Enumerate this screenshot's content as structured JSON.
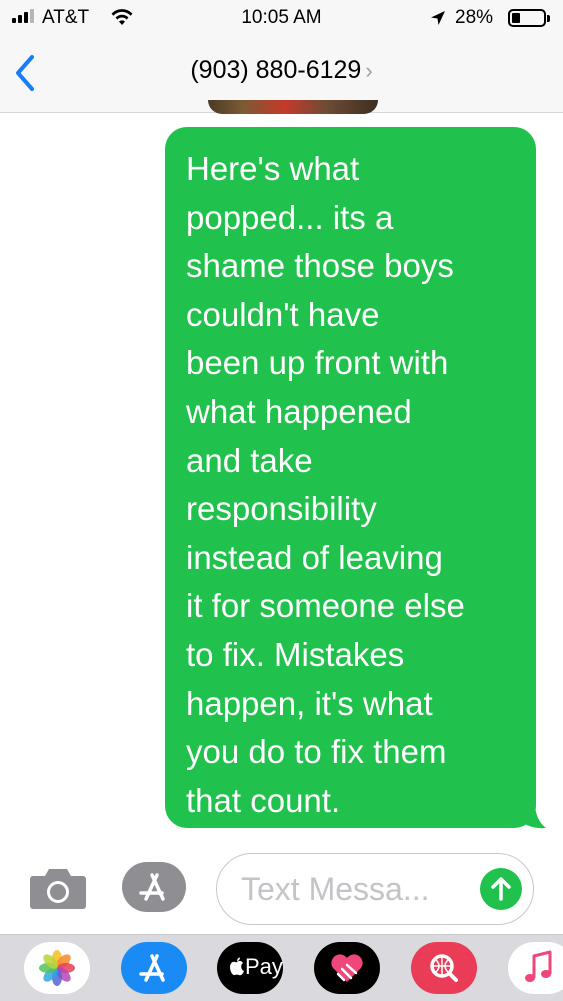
{
  "status_bar": {
    "carrier": "AT&T",
    "time": "10:05 AM",
    "battery_percent": "28%",
    "battery_level": 0.28,
    "icons": [
      "signal-icon",
      "wifi-icon",
      "location-icon",
      "battery-icon"
    ]
  },
  "nav": {
    "contact": "(903) 880-6129",
    "chevron": "›",
    "icons": [
      "back-chevron-icon"
    ]
  },
  "conversation": {
    "messages": [
      {
        "direction": "sent",
        "color": "#21c14d",
        "text": "Here's what\npopped... its a\nshame those boys\ncouldn't have\nbeen up front with\nwhat happened\nand take\nresponsibility\ninstead of leaving\nit for someone else\nto fix. Mistakes\nhappen, it's what\nyou do to fix them\nthat count."
      }
    ]
  },
  "composer": {
    "placeholder": "Text Messa...",
    "icons": [
      "camera-icon",
      "app-store-icon",
      "send-arrow-icon"
    ]
  },
  "app_drawer": {
    "applepay_label": "Pay",
    "apps": [
      "photos-icon",
      "app-store-icon",
      "apple-pay-icon",
      "digital-touch-icon",
      "image-search-icon",
      "music-icon"
    ]
  }
}
